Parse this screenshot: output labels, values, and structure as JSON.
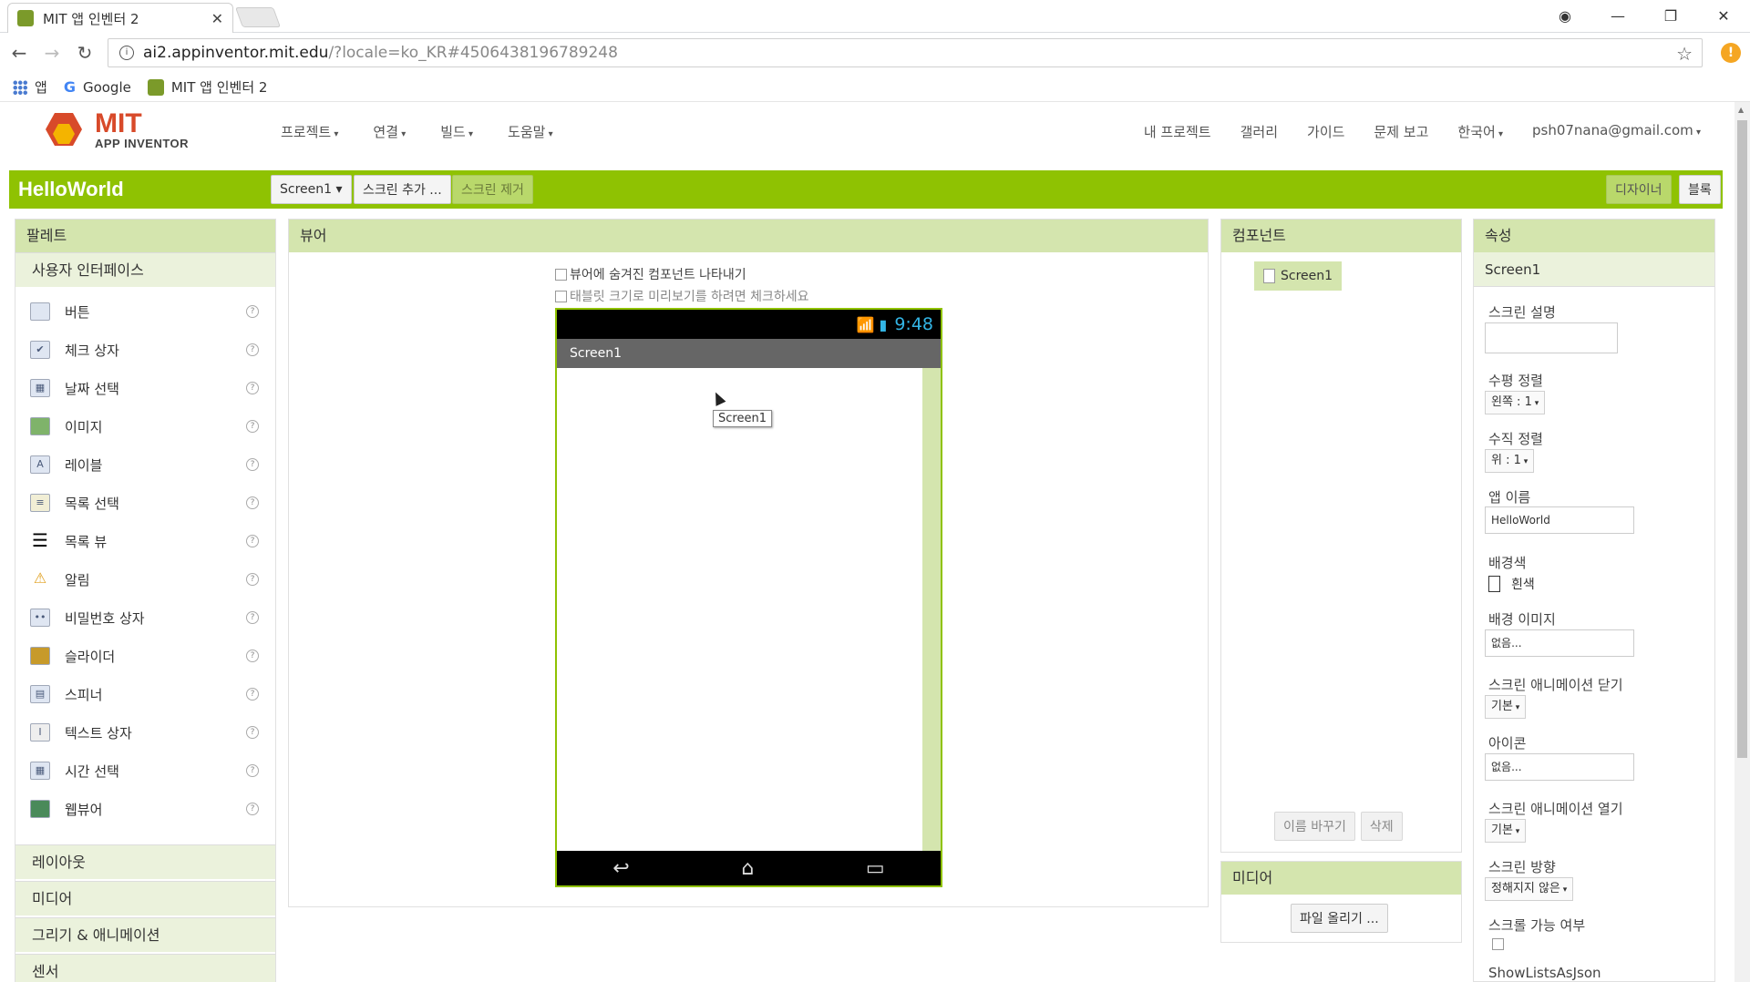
{
  "browser": {
    "tab_title": "MIT 앱 인벤터 2",
    "url_host": "ai2.appinventor.mit.edu",
    "url_path": "/?locale=ko_KR#4506438196789248",
    "bookmarks": [
      "앱",
      "Google",
      "MIT 앱 인벤터 2"
    ]
  },
  "header": {
    "logo_mit": "MIT",
    "logo_sub": "APP INVENTOR",
    "menu": [
      "프로젝트",
      "연결",
      "빌드",
      "도움말"
    ],
    "right_menu": [
      "내 프로젝트",
      "갤러리",
      "가이드",
      "문제 보고",
      "한국어",
      "psh07nana@gmail.com"
    ]
  },
  "toolbar": {
    "project_name": "HelloWorld",
    "screen_select": "Screen1",
    "add_screen": "스크린 추가 ...",
    "remove_screen": "스크린 제거",
    "designer": "디자이너",
    "blocks": "블록"
  },
  "palette": {
    "title": "팔레트",
    "category": "사용자 인터페이스",
    "items": [
      {
        "label": "버튼",
        "icon": "button-icon"
      },
      {
        "label": "체크 상자",
        "icon": "checkbox-icon"
      },
      {
        "label": "날짜 선택",
        "icon": "date-picker-icon"
      },
      {
        "label": "이미지",
        "icon": "image-icon"
      },
      {
        "label": "레이블",
        "icon": "label-icon"
      },
      {
        "label": "목록 선택",
        "icon": "list-picker-icon"
      },
      {
        "label": "목록 뷰",
        "icon": "list-view-icon"
      },
      {
        "label": "알림",
        "icon": "notifier-icon"
      },
      {
        "label": "비밀번호 상자",
        "icon": "password-icon"
      },
      {
        "label": "슬라이더",
        "icon": "slider-icon"
      },
      {
        "label": "스피너",
        "icon": "spinner-icon"
      },
      {
        "label": "텍스트 상자",
        "icon": "textbox-icon"
      },
      {
        "label": "시간 선택",
        "icon": "time-picker-icon"
      },
      {
        "label": "웹뷰어",
        "icon": "webviewer-icon"
      }
    ],
    "other_categories": [
      "레이아웃",
      "미디어",
      "그리기 & 애니메이션",
      "센서"
    ]
  },
  "viewer": {
    "title": "뷰어",
    "show_hidden": "뷰어에 숨겨진 컴포넌트 나타내기",
    "tablet_preview": "태블릿 크기로 미리보기를 하려면 체크하세요",
    "phone_time": "9:48",
    "screen_title": "Screen1",
    "tooltip": "Screen1"
  },
  "components": {
    "title": "컴포넌트",
    "root": "Screen1",
    "rename": "이름 바꾸기",
    "delete": "삭제"
  },
  "media": {
    "title": "미디어",
    "upload": "파일 올리기 ..."
  },
  "properties": {
    "title": "속성",
    "component": "Screen1",
    "about_screen": "스크린 설명",
    "align_h": "수평 정렬",
    "align_h_value": "왼쪽 : 1",
    "align_v": "수직 정렬",
    "align_v_value": "위 : 1",
    "app_name": "앱 이름",
    "app_name_value": "HelloWorld",
    "bg_color": "배경색",
    "bg_color_value": "흰색",
    "bg_image": "배경 이미지",
    "bg_image_value": "없음...",
    "close_anim": "스크린 애니메이션 닫기",
    "close_anim_value": "기본",
    "icon": "아이콘",
    "icon_value": "없음...",
    "open_anim": "스크린 애니메이션 열기",
    "open_anim_value": "기본",
    "orientation": "스크린 방향",
    "orientation_value": "정해지지 않은",
    "scrollable": "스크롤 가능 여부",
    "show_lists": "ShowListsAsJson"
  }
}
